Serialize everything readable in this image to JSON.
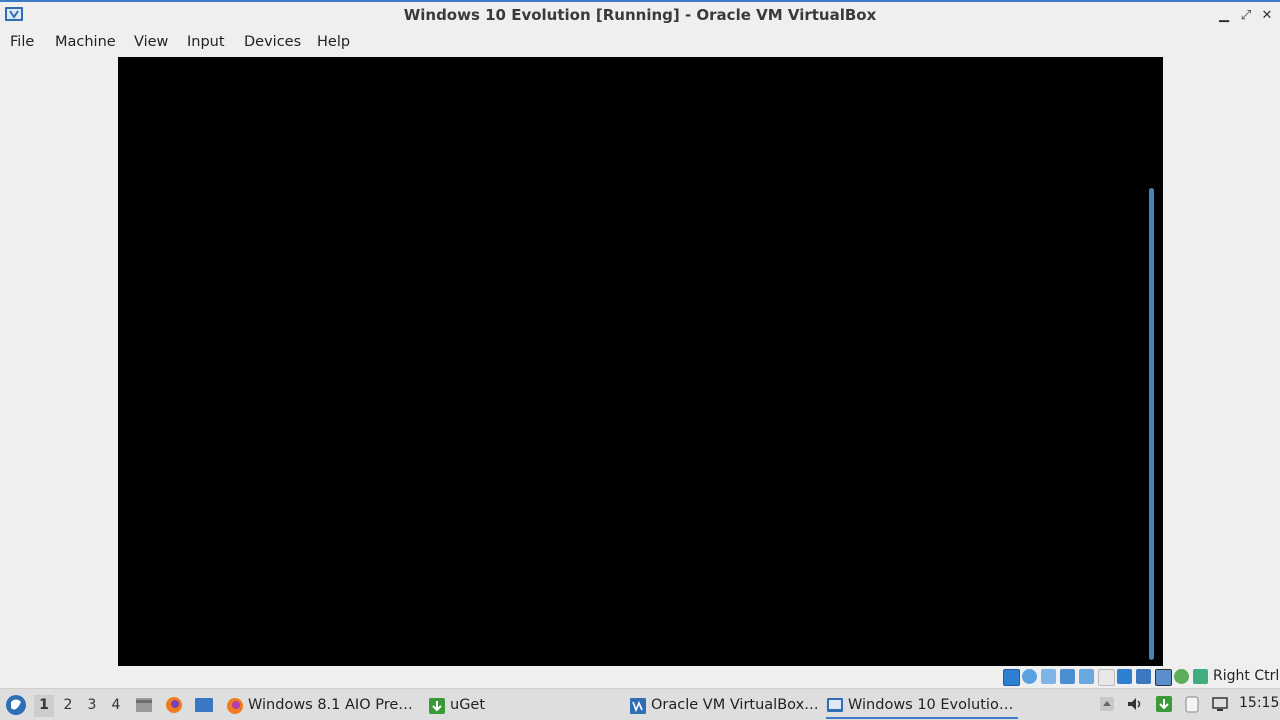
{
  "window": {
    "title": "Windows 10 Evolution [Running] - Oracle VM VirtualBox",
    "controls": {
      "minimize": "▁",
      "maximize": "⤢",
      "close": "✕"
    }
  },
  "menubar": {
    "items": [
      "File",
      "Machine",
      "View",
      "Input",
      "Devices",
      "Help"
    ]
  },
  "statusbar": {
    "host_key": "Right Ctrl",
    "icons": [
      "hard-disk-icon",
      "optical-drive-icon",
      "audio-icon",
      "network-icon",
      "usb-icon",
      "shared-folders-icon",
      "display-icon",
      "video-capture-icon",
      "mouse-integration-icon",
      "keyboard-icon"
    ]
  },
  "taskbar": {
    "workspaces": [
      "1",
      "2",
      "3",
      "4"
    ],
    "active_workspace": "1",
    "tasks": [
      {
        "label": "Windows 8.1 AIO Pre…",
        "icon": "firefox-icon"
      },
      {
        "label": "uGet",
        "icon": "uget-icon"
      },
      {
        "label": "Oracle VM VirtualBox…",
        "icon": "virtualbox-manager-icon"
      },
      {
        "label": "Windows 10 Evolutio…",
        "icon": "virtualbox-vm-icon"
      }
    ],
    "clock": "15:15"
  },
  "colors": {
    "accent": "#3d7cc9",
    "vm_background": "#000000",
    "scrollbar": "#3f86bf"
  }
}
